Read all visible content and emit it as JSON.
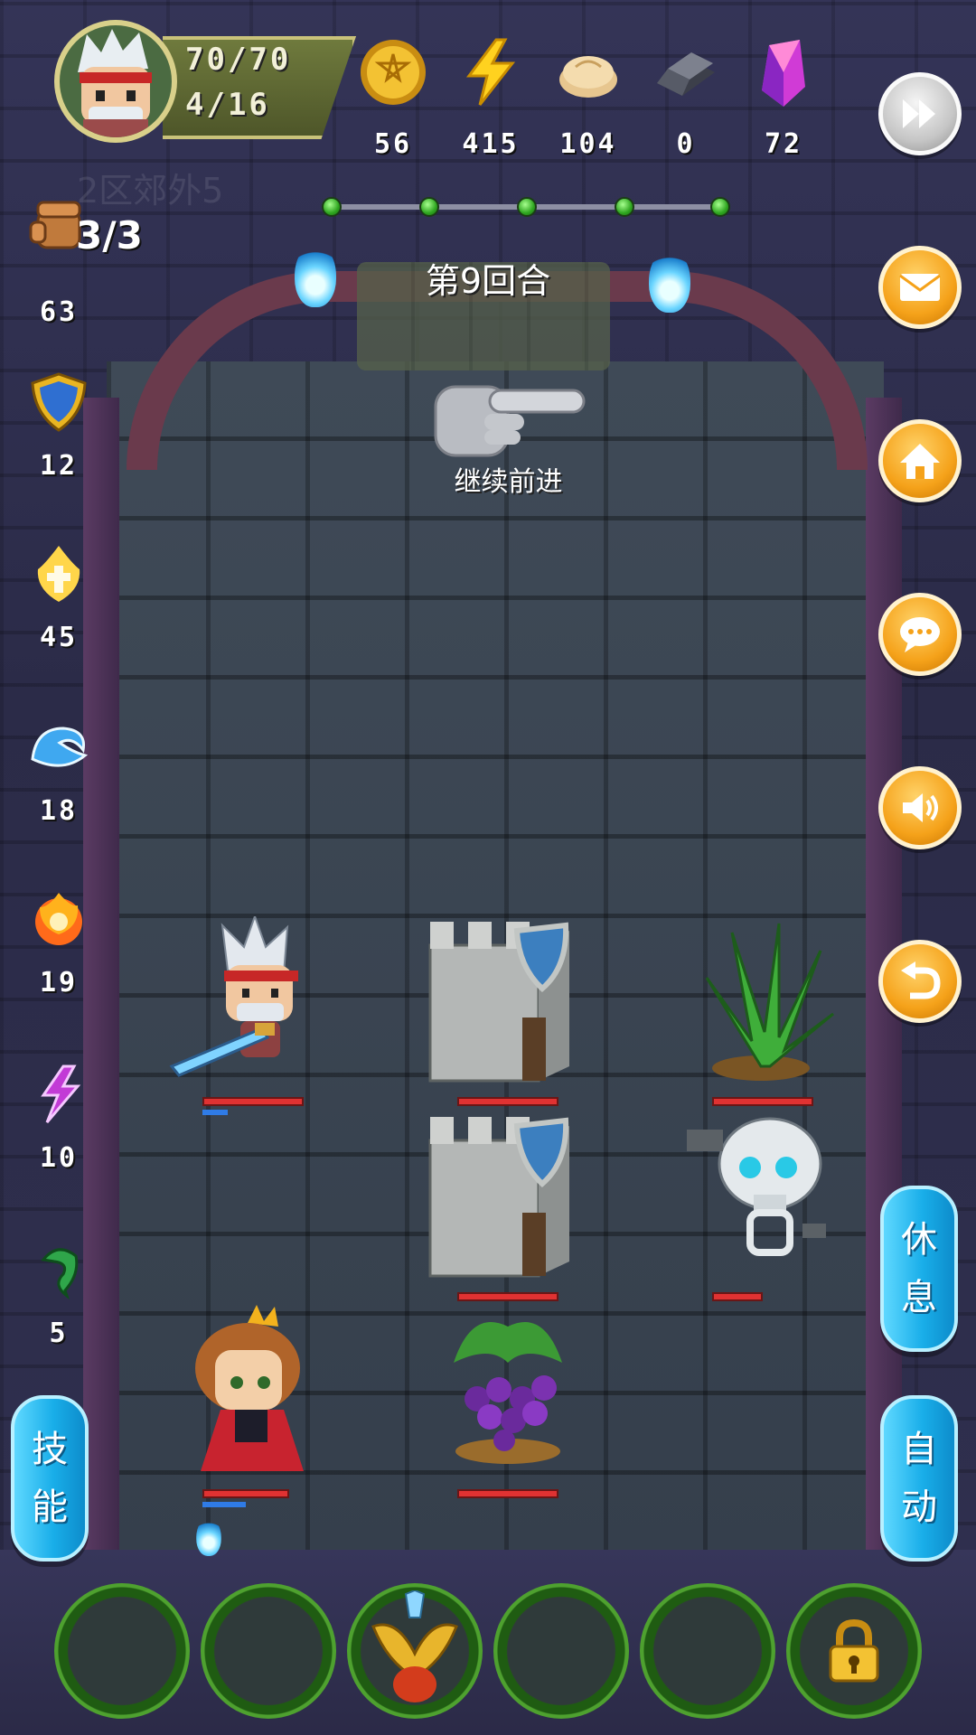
{
  "player": {
    "hp": "70/70",
    "level_progress": "4/16",
    "location": "2区郊外5"
  },
  "resources": [
    {
      "name": "gold-coin",
      "value": "56"
    },
    {
      "name": "energy",
      "value": "415"
    },
    {
      "name": "bun",
      "value": "104"
    },
    {
      "name": "iron-ingot",
      "value": "0"
    },
    {
      "name": "crystal",
      "value": "72"
    }
  ],
  "battle": {
    "round_label": "第9回合",
    "continue_label": "继续前进",
    "stage_dots": 5
  },
  "attributes": {
    "fist": {
      "count": "3/3",
      "value": "63"
    },
    "shield": {
      "value": "12"
    },
    "holy": {
      "value": "45"
    },
    "water": {
      "value": "18"
    },
    "fire": {
      "value": "19"
    },
    "lightning": {
      "value": "10"
    },
    "poison": {
      "value": "5"
    }
  },
  "buttons": {
    "rest": "休息",
    "auto": "自动",
    "skill": "技能"
  },
  "units": {
    "hero_hp": 1.0,
    "hero_mp": 0.25,
    "princess_hp": 1.0,
    "princess_mp": 0.5,
    "tower1_hp": 1.0,
    "tower2_hp": 1.0,
    "plant_hp": 1.0,
    "skeleton_hp": 0.5,
    "grapes_hp": 1.0
  },
  "colors": {
    "accent_orange": "#f5a21a",
    "accent_blue": "#19aee9",
    "hp_red": "#e03232",
    "mp_blue": "#2f7be6"
  }
}
